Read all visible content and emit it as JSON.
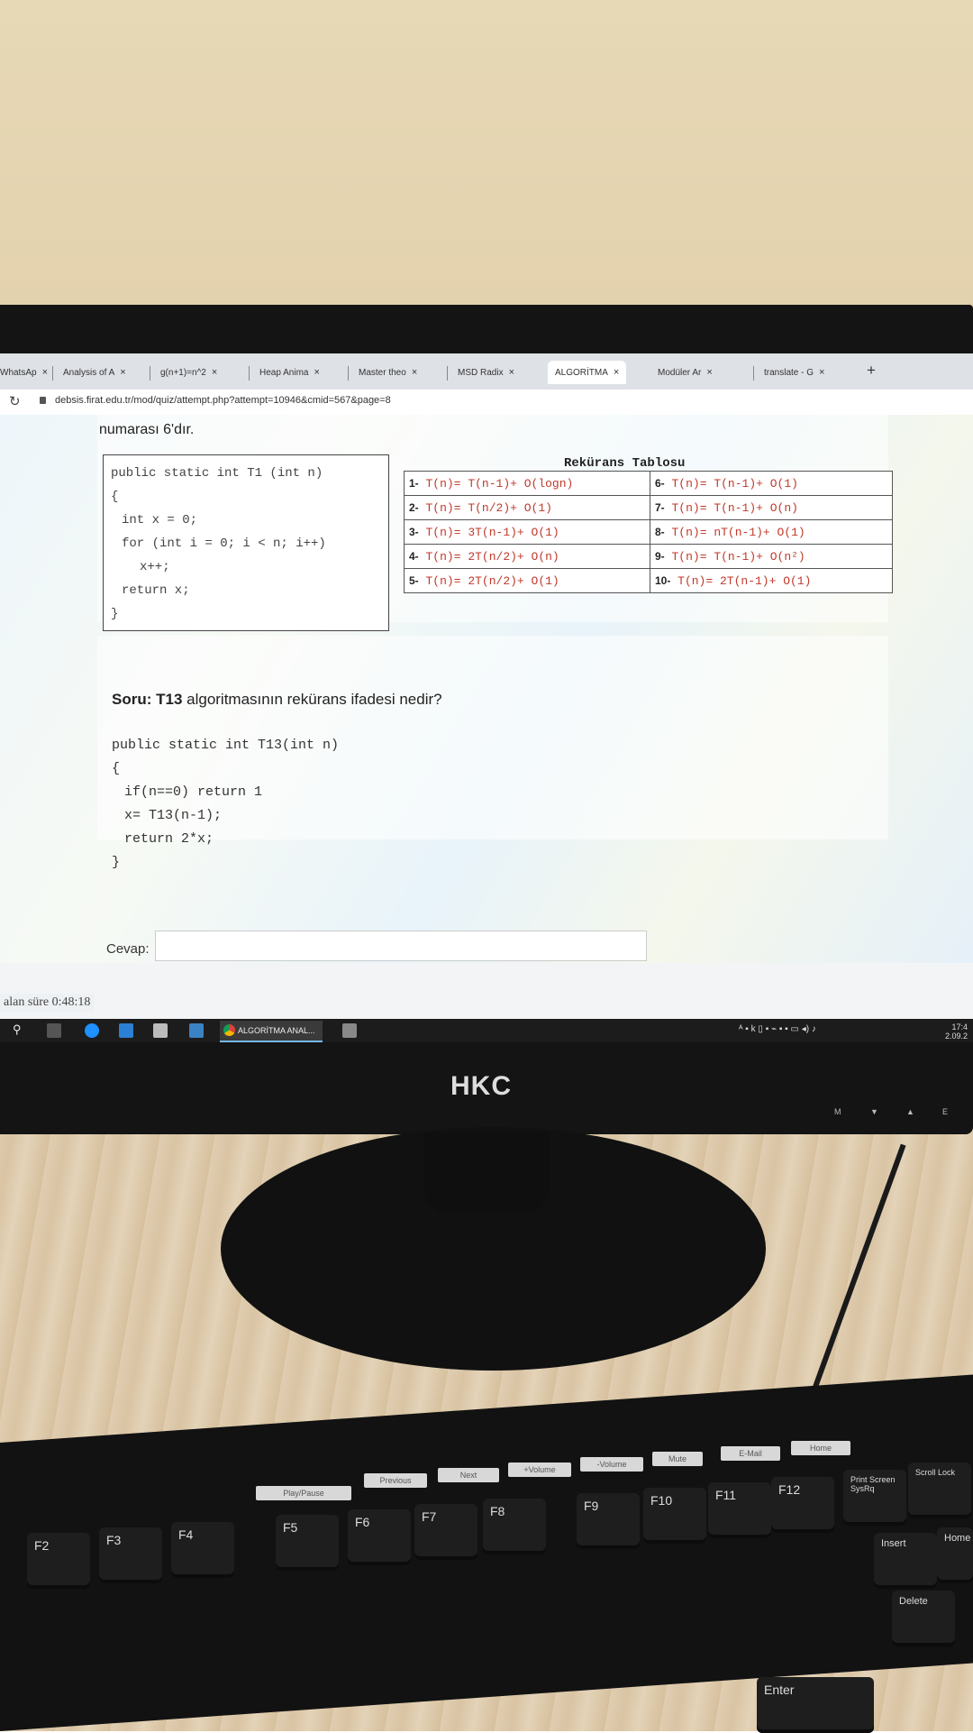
{
  "browser": {
    "tabs": [
      {
        "label": "WhatsAp",
        "close": "×"
      },
      {
        "label": "Analysis of A",
        "close": "×"
      },
      {
        "label": "g(n+1)=n^2",
        "close": "×"
      },
      {
        "label": "Heap Anima",
        "close": "×"
      },
      {
        "label": "Master theo",
        "close": "×"
      },
      {
        "label": "MSD Radix",
        "close": "×"
      },
      {
        "label": "ALGORİTMA",
        "close": "×"
      },
      {
        "label": "Modüler Ar",
        "close": "×"
      },
      {
        "label": "translate - G",
        "close": "×"
      }
    ],
    "new_tab": "+",
    "url": "debsis.firat.edu.tr/mod/quiz/attempt.php?attempt=10946&cmid=567&page=8"
  },
  "quiz": {
    "intro_text": "numarası 6'dır.",
    "code1": {
      "lines": [
        "public static int T1 (int n)",
        "{",
        "int x = 0;",
        "for (int i = 0; i < n; i++)",
        "x++;",
        "return x;",
        "}"
      ]
    },
    "recurrence_table": {
      "title": "Rekürans Tablosu",
      "rows": [
        [
          {
            "num": "1-",
            "lhs": "T(n)=",
            "rhs": "T(n-1)+ O(logn)"
          },
          {
            "num": "6-",
            "lhs": "T(n)=",
            "rhs": "T(n-1)+ O(1)"
          }
        ],
        [
          {
            "num": "2-",
            "lhs": "T(n)=",
            "rhs": "T(n/2)+ O(1)"
          },
          {
            "num": "7-",
            "lhs": "T(n)=",
            "rhs": "T(n-1)+ O(n)"
          }
        ],
        [
          {
            "num": "3-",
            "lhs": "T(n)=",
            "rhs": "3T(n-1)+ O(1)"
          },
          {
            "num": "8-",
            "lhs": "T(n)=",
            "rhs": "nT(n-1)+ O(1)"
          }
        ],
        [
          {
            "num": "4-",
            "lhs": "T(n)=",
            "rhs": "2T(n/2)+ O(n)"
          },
          {
            "num": "9-",
            "lhs": "T(n)=",
            "rhs": "T(n-1)+ O(n²)"
          }
        ],
        [
          {
            "num": "5-",
            "lhs": "T(n)=",
            "rhs": "2T(n/2)+ O(1)"
          },
          {
            "num": "10-",
            "lhs": "T(n)=",
            "rhs": "2T(n-1)+ O(1)"
          }
        ]
      ]
    },
    "question_label": "Soru: T13",
    "question_text": " algoritmasının rekürans ifadesi nedir?",
    "code2": {
      "lines": [
        "public static int T13(int n)",
        "{",
        "if(n==0) return 1",
        "x= T13(n-1);",
        "return 2*x;",
        "}"
      ]
    },
    "answer_label": "Cevap:",
    "answer_value": "",
    "timer": "alan süre 0:48:18"
  },
  "taskbar": {
    "app_label": "ALGORİTMA ANAL...",
    "time": "17:4",
    "date": "2.09.2"
  },
  "monitor": {
    "brand": "HKC",
    "buttons": [
      "M",
      "▼",
      "▲",
      "E"
    ]
  },
  "keyboard": {
    "media_keys": [
      "Play/Pause",
      "Previous",
      "Next",
      "+Volume",
      "-Volume",
      "Mute",
      "E-Mail",
      "Home"
    ],
    "keys": [
      "F2",
      "F3",
      "F4",
      "F5",
      "F6",
      "F7",
      "F8",
      "F9",
      "F10",
      "F11",
      "F12",
      "Print Screen SysRq",
      "Scroll Lock",
      "Insert",
      "Home",
      "Delete",
      "Enter"
    ]
  }
}
